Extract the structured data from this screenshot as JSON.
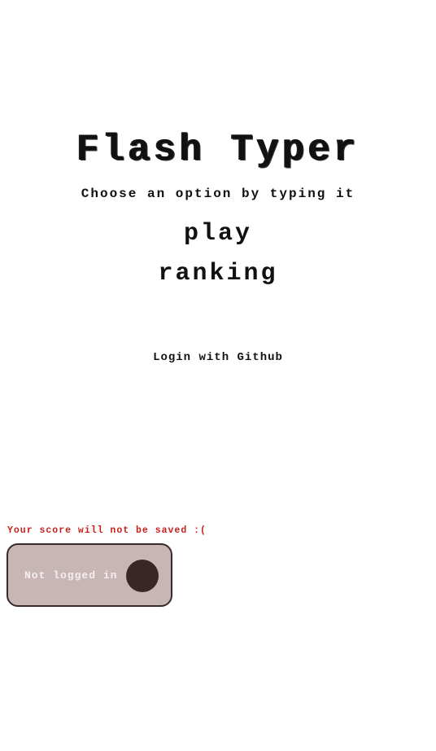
{
  "app": {
    "title": "Flash Typer",
    "instruction": "Choose an option by typing it"
  },
  "menu": {
    "options": [
      {
        "label": "play"
      },
      {
        "label": "ranking"
      }
    ]
  },
  "auth": {
    "login_label": "Login with Github"
  },
  "status": {
    "warning": "Your score will not be saved :(",
    "user_status": "Not logged in",
    "avatar_icon": "avatar-placeholder-icon",
    "colors": {
      "warning": "#c8201c",
      "card_background": "#c7b6b5",
      "avatar": "#3b2626"
    }
  }
}
